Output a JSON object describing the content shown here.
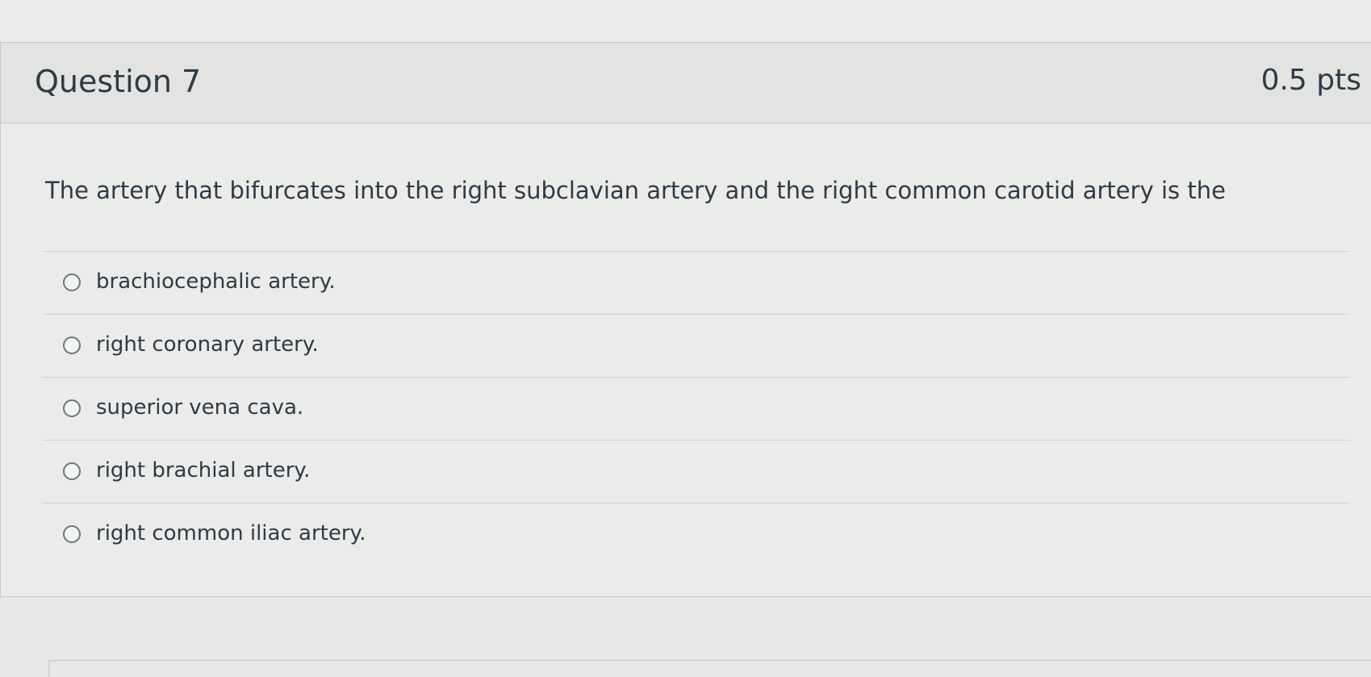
{
  "question": {
    "title": "Question 7",
    "points": "0.5 pts",
    "text": "The artery that bifurcates into the right subclavian artery and the right common carotid artery is the",
    "answers": [
      {
        "label": "brachiocephalic artery."
      },
      {
        "label": "right coronary artery."
      },
      {
        "label": "superior vena cava."
      },
      {
        "label": "right brachial artery."
      },
      {
        "label": "right common iliac artery."
      }
    ]
  },
  "icons": {
    "radio": "radio-unchecked-icon"
  }
}
